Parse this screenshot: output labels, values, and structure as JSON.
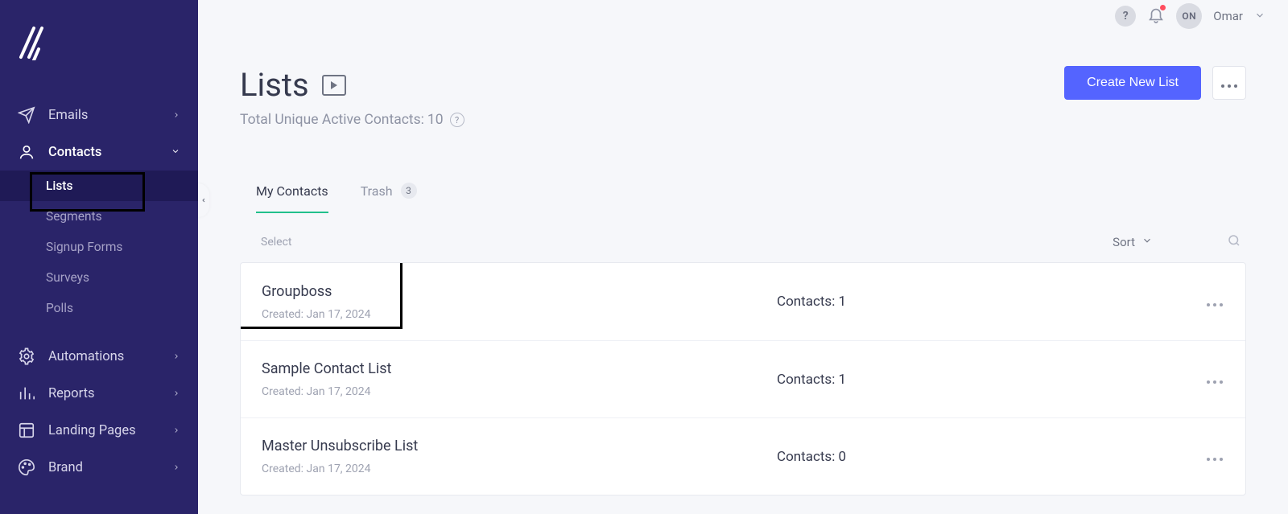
{
  "sidebar": {
    "nav": [
      {
        "id": "emails",
        "label": "Emails",
        "icon": "paper-plane-icon",
        "expandable": true,
        "active": false
      },
      {
        "id": "contacts",
        "label": "Contacts",
        "icon": "person-icon",
        "expandable": true,
        "active": true,
        "children": [
          {
            "id": "lists",
            "label": "Lists",
            "active": true
          },
          {
            "id": "segments",
            "label": "Segments",
            "active": false
          },
          {
            "id": "signup-forms",
            "label": "Signup Forms",
            "active": false
          },
          {
            "id": "surveys",
            "label": "Surveys",
            "active": false
          },
          {
            "id": "polls",
            "label": "Polls",
            "active": false
          }
        ]
      },
      {
        "id": "automations",
        "label": "Automations",
        "icon": "gear-icon",
        "expandable": true,
        "active": false
      },
      {
        "id": "reports",
        "label": "Reports",
        "icon": "bar-chart-icon",
        "expandable": true,
        "active": false
      },
      {
        "id": "landing",
        "label": "Landing Pages",
        "icon": "layout-icon",
        "expandable": true,
        "active": false
      },
      {
        "id": "brand",
        "label": "Brand",
        "icon": "palette-icon",
        "expandable": true,
        "active": false
      }
    ]
  },
  "topbar": {
    "help_tooltip": "?",
    "avatar_initials": "ON",
    "username": "Omar"
  },
  "page": {
    "title": "Lists",
    "subtitle_prefix": "Total Unique Active Contacts: ",
    "total_contacts": "10",
    "create_button": "Create New List"
  },
  "tabs": [
    {
      "id": "my-contacts",
      "label": "My Contacts",
      "active": true
    },
    {
      "id": "trash",
      "label": "Trash",
      "count": "3",
      "active": false
    }
  ],
  "toolbar": {
    "select_label": "Select",
    "sort_label": "Sort"
  },
  "lists": [
    {
      "name": "Groupboss",
      "created_label": "Created: Jan 17, 2024",
      "contacts_label": "Contacts: 1"
    },
    {
      "name": "Sample Contact List",
      "created_label": "Created: Jan 17, 2024",
      "contacts_label": "Contacts: 1"
    },
    {
      "name": "Master Unsubscribe List",
      "created_label": "Created: Jan 17, 2024",
      "contacts_label": "Contacts: 0"
    }
  ]
}
